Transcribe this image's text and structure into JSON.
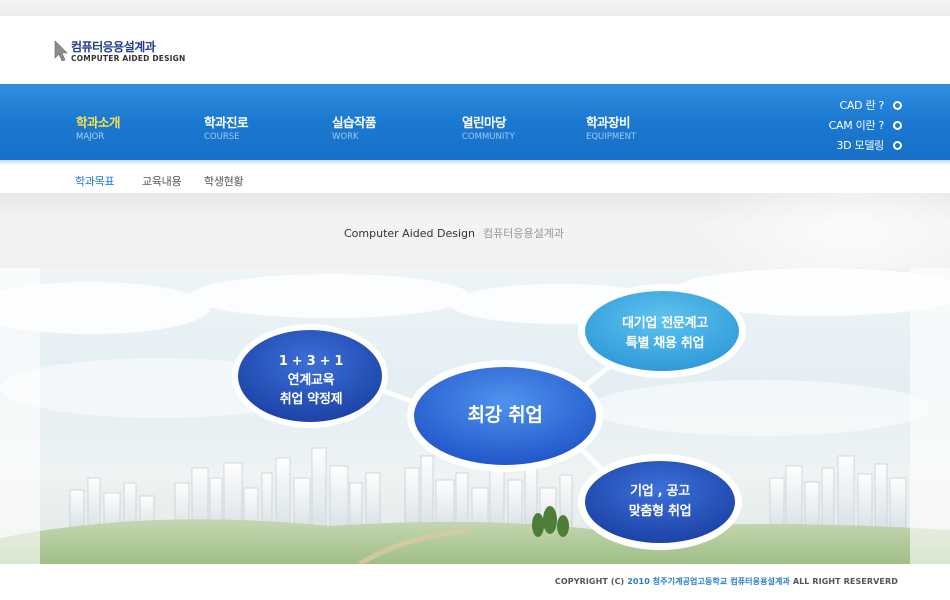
{
  "logo": {
    "korean": "컴퓨터응용설계과",
    "english": "COMPUTER AIDED DESIGN"
  },
  "nav": {
    "items": [
      {
        "kr": "학과소개",
        "en": "MAJOR"
      },
      {
        "kr": "학과진로",
        "en": "COURSE"
      },
      {
        "kr": "실습작품",
        "en": "WORK"
      },
      {
        "kr": "열린마당",
        "en": "COMMUNITY"
      },
      {
        "kr": "학과장비",
        "en": "EQUIPMENT"
      }
    ],
    "active_index": 0
  },
  "quick_links": [
    {
      "label": "CAD 란 ?"
    },
    {
      "label": "CAM 이란 ?"
    },
    {
      "label": "3D 모델링"
    }
  ],
  "subnav": {
    "items": [
      "학과목표",
      "교육내용",
      "학생현황"
    ],
    "active_index": 0
  },
  "band": {
    "english": "Computer Aided Design",
    "korean": "컴퓨터응용설계과"
  },
  "visual": {
    "left_bubble": [
      "1 + 3 + 1",
      "연계교육",
      "취업 약정제"
    ],
    "center_bubble": "최강 취업",
    "top_right_bubble": [
      "대기업 전문계고",
      "특별 채용 취업"
    ],
    "bottom_right_bubble": [
      "기업 , 공고",
      "맞춤형 취업"
    ]
  },
  "footer": {
    "prefix": "COPYRIGHT (C)",
    "highlight": "2010 청주기계공업고등학교 컴퓨터응용설계과",
    "suffix": "ALL RIGHT RESERVERD"
  },
  "colors": {
    "nav_blue": "#1b78d1",
    "active_yellow": "#ffe24a",
    "sub_active": "#1a7ad6"
  }
}
